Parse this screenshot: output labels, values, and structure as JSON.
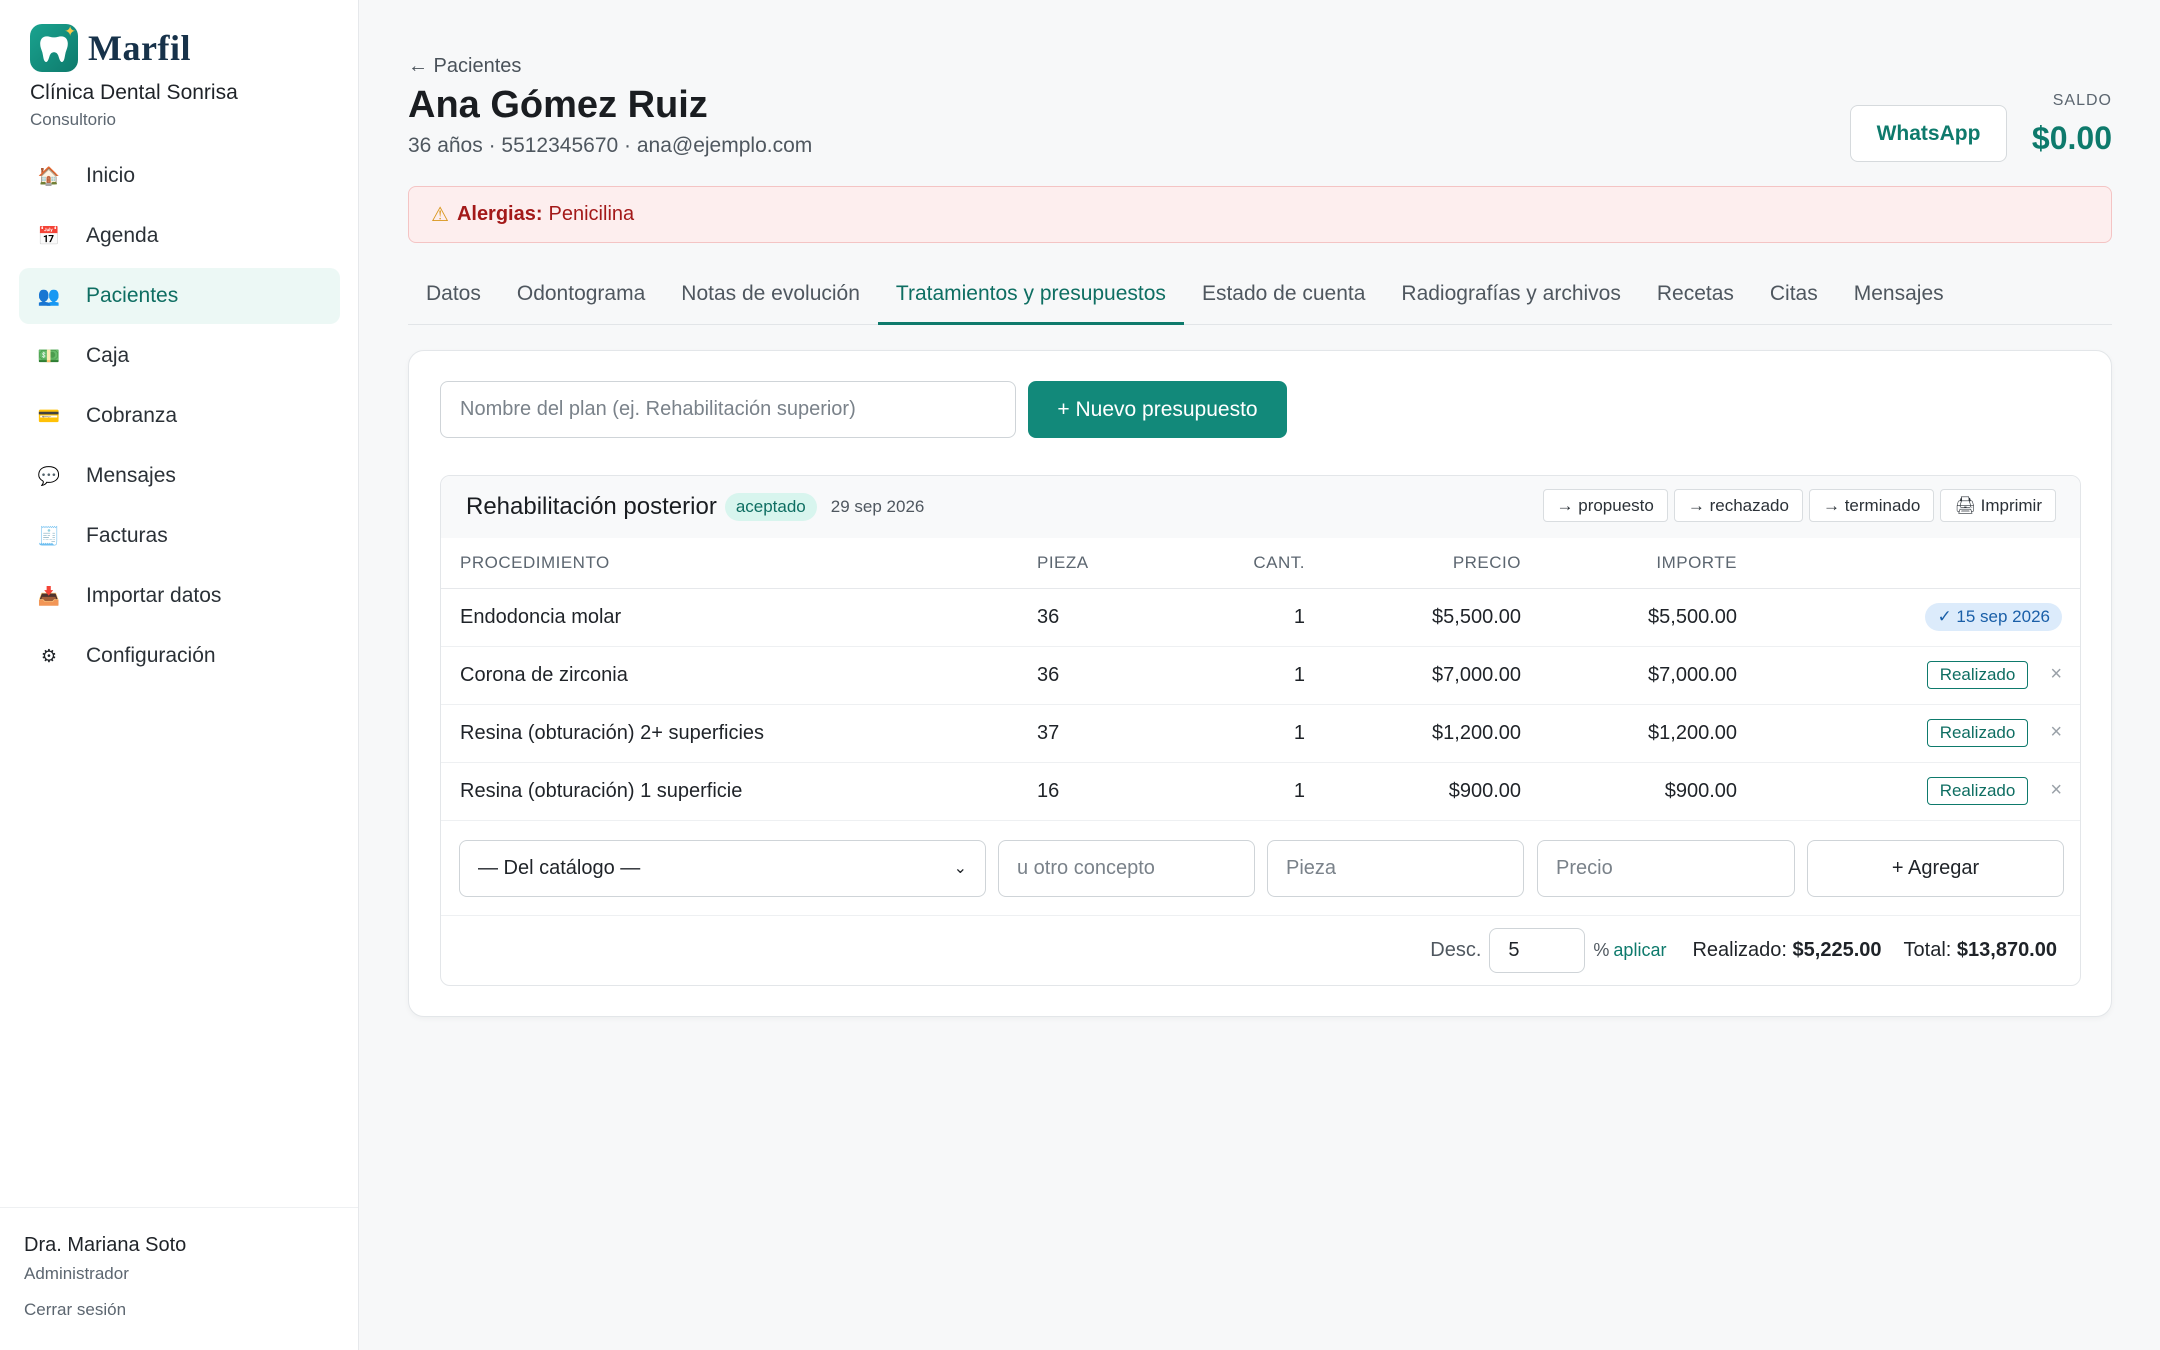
{
  "brand": {
    "name": "Marfil",
    "clinic": "Clínica Dental Sonrisa",
    "subtitle": "Consultorio"
  },
  "nav": [
    {
      "label": "Inicio",
      "icon": "house-icon",
      "glyph": "🏠"
    },
    {
      "label": "Agenda",
      "icon": "calendar-icon",
      "glyph": "📅"
    },
    {
      "label": "Pacientes",
      "icon": "people-icon",
      "glyph": "👥",
      "active": true
    },
    {
      "label": "Caja",
      "icon": "cash-icon",
      "glyph": "💵"
    },
    {
      "label": "Cobranza",
      "icon": "credit-card-icon",
      "glyph": "💳"
    },
    {
      "label": "Mensajes",
      "icon": "speech-bubble-icon",
      "glyph": "💬"
    },
    {
      "label": "Facturas",
      "icon": "receipt-icon",
      "glyph": "🧾"
    },
    {
      "label": "Importar datos",
      "icon": "inbox-tray-icon",
      "glyph": "📥"
    },
    {
      "label": "Configuración",
      "icon": "gear-icon",
      "glyph": "⚙"
    }
  ],
  "user": {
    "name": "Dra. Mariana Soto",
    "role": "Administrador",
    "logout": "Cerrar sesión"
  },
  "patient": {
    "back": "← Pacientes",
    "name": "Ana Gómez Ruiz",
    "meta": "36 años · 5512345670 · ana@ejemplo.com",
    "whatsapp": "WhatsApp",
    "saldo_label": "SALDO",
    "saldo_value": "$0.00"
  },
  "alert": {
    "label": "Alergias:",
    "value": "Penicilina",
    "icon": "warning-icon"
  },
  "tabs": [
    {
      "label": "Datos"
    },
    {
      "label": "Odontograma"
    },
    {
      "label": "Notas de evolución"
    },
    {
      "label": "Tratamientos y presupuestos",
      "active": true
    },
    {
      "label": "Estado de cuenta"
    },
    {
      "label": "Radiografías y archivos"
    },
    {
      "label": "Recetas"
    },
    {
      "label": "Citas"
    },
    {
      "label": "Mensajes"
    }
  ],
  "plan": {
    "placeholder": "Nombre del plan (ej. Rehabilitación superior)",
    "new_button": "+ Nuevo presupuesto"
  },
  "budget": {
    "title": "Rehabilitación posterior",
    "status": "aceptado",
    "date": "29 sep 2026",
    "actions": [
      "→ propuesto",
      "→ rechazado",
      "→ terminado",
      "🖨 Imprimir"
    ],
    "columns": [
      "PROCEDIMIENTO",
      "PIEZA",
      "CANT.",
      "PRECIO",
      "IMPORTE"
    ],
    "rows": [
      {
        "proc": "Endodoncia molar",
        "pieza": "36",
        "cant": "1",
        "precio": "$5,500.00",
        "importe": "$5,500.00",
        "done": "✓ 15 sep 2026"
      },
      {
        "proc": "Corona de zirconia",
        "pieza": "36",
        "cant": "1",
        "precio": "$7,000.00",
        "importe": "$7,000.00",
        "action": "Realizado"
      },
      {
        "proc": "Resina (obturación) 2+ superficies",
        "pieza": "37",
        "cant": "1",
        "precio": "$1,200.00",
        "importe": "$1,200.00",
        "action": "Realizado"
      },
      {
        "proc": "Resina (obturación) 1 superficie",
        "pieza": "16",
        "cant": "1",
        "precio": "$900.00",
        "importe": "$900.00",
        "action": "Realizado"
      }
    ],
    "add": {
      "catalog": "— Del catálogo —",
      "otro_placeholder": "u otro concepto",
      "pieza_placeholder": "Pieza",
      "precio_placeholder": "Precio",
      "add_button": "+ Agregar"
    },
    "totals": {
      "desc_label": "Desc.",
      "desc_value": "5",
      "pct": "%",
      "aplicar": "aplicar",
      "realizado_label": "Realizado:",
      "realizado_value": "$5,225.00",
      "total_label": "Total:",
      "total_value": "$13,870.00"
    }
  },
  "colors": {
    "accent": "#0e7a6c",
    "alert_text": "#a31919",
    "alert_bg": "#fdeeee"
  }
}
